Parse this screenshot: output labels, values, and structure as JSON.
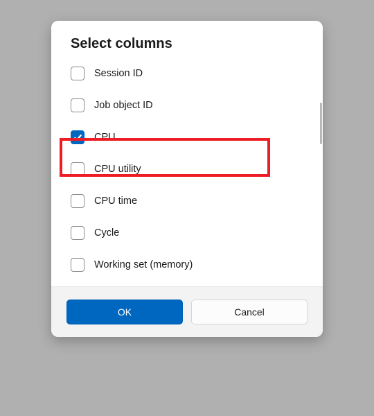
{
  "dialog": {
    "title": "Select columns",
    "items": [
      {
        "label": "Session ID",
        "checked": false
      },
      {
        "label": "Job object ID",
        "checked": false
      },
      {
        "label": "CPU",
        "checked": true
      },
      {
        "label": "CPU utility",
        "checked": false
      },
      {
        "label": "CPU time",
        "checked": false
      },
      {
        "label": "Cycle",
        "checked": false
      },
      {
        "label": "Working set (memory)",
        "checked": false
      }
    ],
    "buttons": {
      "ok": "OK",
      "cancel": "Cancel"
    }
  },
  "colors": {
    "accent": "#0067c0",
    "highlight": "#ee1c25"
  }
}
